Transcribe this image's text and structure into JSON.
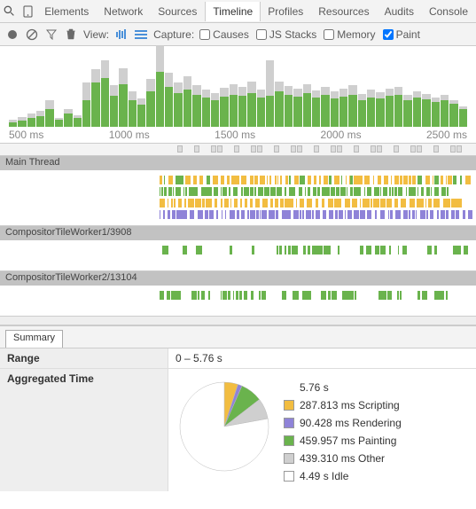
{
  "tabs": [
    "Elements",
    "Network",
    "Sources",
    "Timeline",
    "Profiles",
    "Resources",
    "Audits",
    "Console"
  ],
  "activeTab": "Timeline",
  "toolbar": {
    "view_label": "View:",
    "capture_label": "Capture:",
    "checks": [
      {
        "label": "Causes",
        "checked": false
      },
      {
        "label": "JS Stacks",
        "checked": false
      },
      {
        "label": "Memory",
        "checked": false
      },
      {
        "label": "Paint",
        "checked": true
      }
    ]
  },
  "colors": {
    "scripting": "#f2bd41",
    "rendering": "#8f83d8",
    "painting": "#6ab34d",
    "other": "#cfcfcf",
    "idle": "#ffffff"
  },
  "overview": {
    "ticks": [
      "500 ms",
      "1000 ms",
      "1500 ms",
      "2000 ms",
      "2500 ms"
    ],
    "bars": [
      {
        "p": 5,
        "o": 3
      },
      {
        "p": 7,
        "o": 4
      },
      {
        "p": 10,
        "o": 5
      },
      {
        "p": 12,
        "o": 6
      },
      {
        "p": 20,
        "o": 10
      },
      {
        "p": 8,
        "o": 2
      },
      {
        "p": 15,
        "o": 5
      },
      {
        "p": 10,
        "o": 3
      },
      {
        "p": 30,
        "o": 20
      },
      {
        "p": 50,
        "o": 15
      },
      {
        "p": 55,
        "o": 20
      },
      {
        "p": 35,
        "o": 12
      },
      {
        "p": 48,
        "o": 18
      },
      {
        "p": 30,
        "o": 10
      },
      {
        "p": 25,
        "o": 7
      },
      {
        "p": 40,
        "o": 14
      },
      {
        "p": 62,
        "o": 30
      },
      {
        "p": 45,
        "o": 16
      },
      {
        "p": 38,
        "o": 12
      },
      {
        "p": 42,
        "o": 15
      },
      {
        "p": 36,
        "o": 11
      },
      {
        "p": 33,
        "o": 9
      },
      {
        "p": 30,
        "o": 8
      },
      {
        "p": 34,
        "o": 10
      },
      {
        "p": 36,
        "o": 12
      },
      {
        "p": 35,
        "o": 10
      },
      {
        "p": 38,
        "o": 13
      },
      {
        "p": 33,
        "o": 9
      },
      {
        "p": 35,
        "o": 40
      },
      {
        "p": 40,
        "o": 11
      },
      {
        "p": 36,
        "o": 10
      },
      {
        "p": 34,
        "o": 9
      },
      {
        "p": 38,
        "o": 10
      },
      {
        "p": 33,
        "o": 8
      },
      {
        "p": 36,
        "o": 9
      },
      {
        "p": 32,
        "o": 8
      },
      {
        "p": 34,
        "o": 9
      },
      {
        "p": 36,
        "o": 11
      },
      {
        "p": 30,
        "o": 7
      },
      {
        "p": 33,
        "o": 9
      },
      {
        "p": 32,
        "o": 7
      },
      {
        "p": 35,
        "o": 8
      },
      {
        "p": 36,
        "o": 9
      },
      {
        "p": 30,
        "o": 6
      },
      {
        "p": 33,
        "o": 7
      },
      {
        "p": 31,
        "o": 6
      },
      {
        "p": 28,
        "o": 5
      },
      {
        "p": 30,
        "o": 6
      },
      {
        "p": 26,
        "o": 4
      },
      {
        "p": 20,
        "o": 3
      }
    ]
  },
  "threads": [
    {
      "name": "Main Thread",
      "tracks": 4
    },
    {
      "name": "CompositorTileWorker1/3908",
      "tracks": 1
    },
    {
      "name": "CompositorTileWorker2/13104",
      "tracks": 1
    }
  ],
  "summary": {
    "tab": "Summary",
    "range_label": "Range",
    "range_value": "0 – 5.76 s",
    "agg_label": "Aggregated Time",
    "total": "5.76 s",
    "items": [
      {
        "color": "#f2bd41",
        "label": "287.813 ms Scripting",
        "value": 287.813
      },
      {
        "color": "#8f83d8",
        "label": "90.428 ms Rendering",
        "value": 90.428
      },
      {
        "color": "#6ab34d",
        "label": "459.957 ms Painting",
        "value": 459.957
      },
      {
        "color": "#cfcfcf",
        "label": "439.310 ms Other",
        "value": 439.31
      },
      {
        "color": "#ffffff",
        "label": "4.49 s Idle",
        "value": 4490
      }
    ]
  },
  "chart_data": {
    "type": "pie",
    "title": "Aggregated Time",
    "total_seconds": 5.76,
    "series": [
      {
        "name": "Scripting",
        "value_ms": 287.813,
        "color": "#f2bd41"
      },
      {
        "name": "Rendering",
        "value_ms": 90.428,
        "color": "#8f83d8"
      },
      {
        "name": "Painting",
        "value_ms": 459.957,
        "color": "#6ab34d"
      },
      {
        "name": "Other",
        "value_ms": 439.31,
        "color": "#cfcfcf"
      },
      {
        "name": "Idle",
        "value_ms": 4490,
        "color": "#ffffff"
      }
    ]
  }
}
